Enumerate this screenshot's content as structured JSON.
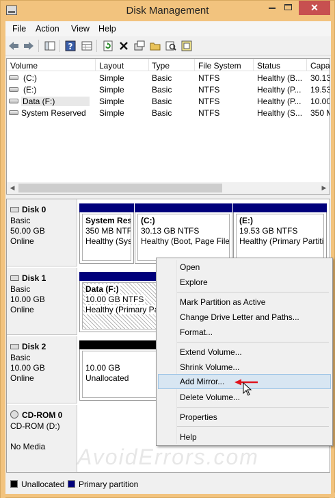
{
  "window": {
    "title": "Disk Management",
    "close_glyph": "✕"
  },
  "menu": [
    "File",
    "Action",
    "View",
    "Help"
  ],
  "toolbar": {
    "icons": [
      "back-arrow-icon",
      "forward-arrow-icon",
      "console-tree-icon",
      "help-icon",
      "properties-grid-icon",
      "refresh-icon",
      "delete-icon",
      "properties-icon",
      "open-folder-icon",
      "search-icon",
      "rescan-icon"
    ]
  },
  "volume_table": {
    "columns": [
      "Volume",
      "Layout",
      "Type",
      "File System",
      "Status",
      "Capa"
    ],
    "rows": [
      {
        "volume": "(C:)",
        "layout": "Simple",
        "type": "Basic",
        "fs": "NTFS",
        "status": "Healthy (B...",
        "capacity": "30.13"
      },
      {
        "volume": "(E:)",
        "layout": "Simple",
        "type": "Basic",
        "fs": "NTFS",
        "status": "Healthy (P...",
        "capacity": "19.53"
      },
      {
        "volume": "Data (F:)",
        "layout": "Simple",
        "type": "Basic",
        "fs": "NTFS",
        "status": "Healthy (P...",
        "capacity": "10.00"
      },
      {
        "volume": "System Reserved",
        "layout": "Simple",
        "type": "Basic",
        "fs": "NTFS",
        "status": "Healthy (S...",
        "capacity": "350 M"
      }
    ],
    "scroll_left": "◀",
    "scroll_right": "▶"
  },
  "disks": [
    {
      "name": "Disk 0",
      "type": "Basic",
      "size": "50.00 GB",
      "state": "Online",
      "partitions": [
        {
          "name": "System Res",
          "size": "350 MB NTFS",
          "status": "Healthy (Sys"
        },
        {
          "name": "(C:)",
          "size": "30.13 GB NTFS",
          "status": "Healthy (Boot, Page File,"
        },
        {
          "name": "(E:)",
          "size": "19.53 GB NTFS",
          "status": "Healthy (Primary Partiti"
        }
      ]
    },
    {
      "name": "Disk 1",
      "type": "Basic",
      "size": "10.00 GB",
      "state": "Online",
      "partitions": [
        {
          "name": "Data  (F:)",
          "size": "10.00 GB NTFS",
          "status": "Healthy (Primary Pa"
        }
      ]
    },
    {
      "name": "Disk 2",
      "type": "Basic",
      "size": "10.00 GB",
      "state": "Online",
      "partitions": [
        {
          "name": "",
          "size": "10.00 GB",
          "status": "Unallocated"
        }
      ]
    },
    {
      "name": "CD-ROM 0",
      "type": "CD-ROM (D:)",
      "size": "",
      "state": "No Media",
      "partitions": []
    }
  ],
  "legend": [
    {
      "label": "Unallocated",
      "color": "#000000"
    },
    {
      "label": "Primary partition",
      "color": "#00007b"
    }
  ],
  "context_menu": {
    "items": [
      {
        "label": "Open"
      },
      {
        "label": "Explore"
      },
      {
        "label": "Mark Partition as Active"
      },
      {
        "label": "Change Drive Letter and Paths..."
      },
      {
        "label": "Format..."
      },
      {
        "label": "Extend Volume..."
      },
      {
        "label": "Shrink Volume..."
      },
      {
        "label": "Add Mirror...",
        "highlighted": true
      },
      {
        "label": "Delete Volume..."
      },
      {
        "label": "Properties"
      },
      {
        "label": "Help"
      }
    ]
  },
  "watermark": "AvoidErrors.com"
}
